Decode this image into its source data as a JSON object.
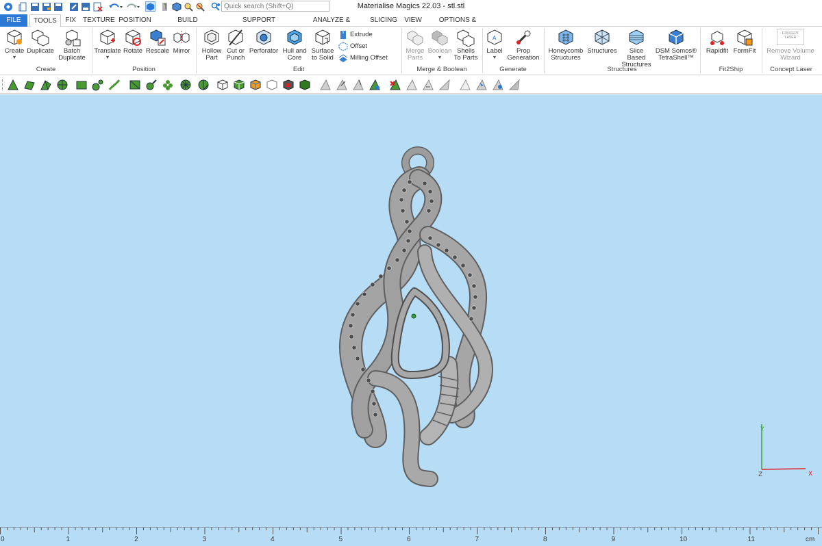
{
  "app": {
    "title": "Materialise Magics 22.03 - stl.stl"
  },
  "quick_search": {
    "placeholder": "Quick search (Shift+Q)"
  },
  "menu_tabs": [
    {
      "label": "FILE"
    },
    {
      "label": "TOOLS"
    },
    {
      "label": "FIX"
    },
    {
      "label": "TEXTURE"
    },
    {
      "label": "POSITION"
    },
    {
      "label": "BUILD PREPARATION"
    },
    {
      "label": "SUPPORT GENERATION"
    },
    {
      "label": "ANALYZE & REPORT"
    },
    {
      "label": "SLICING"
    },
    {
      "label": "VIEW"
    },
    {
      "label": "OPTIONS & HELP"
    }
  ],
  "active_tab": "TOOLS",
  "ribbon": {
    "create": {
      "group_label": "Create",
      "create": "Create",
      "duplicate": "Duplicate",
      "batch_duplicate_1": "Batch",
      "batch_duplicate_2": "Duplicate"
    },
    "position": {
      "group_label": "Position",
      "translate": "Translate",
      "rotate": "Rotate",
      "rescale": "Rescale",
      "mirror": "Mirror"
    },
    "edit": {
      "group_label": "Edit",
      "hollow_1": "Hollow",
      "hollow_2": "Part",
      "cut_1": "Cut or",
      "cut_2": "Punch",
      "perforator": "Perforator",
      "hull_1": "Hull and",
      "hull_2": "Core",
      "surface_1": "Surface",
      "surface_2": "to Solid",
      "extrude": "Extrude",
      "offset": "Offset",
      "milling_offset": "Milling Offset"
    },
    "merge": {
      "group_label": "Merge & Boolean",
      "merge_1": "Merge",
      "merge_2": "Parts",
      "boolean": "Boolean",
      "shells_1": "Shells",
      "shells_2": "To Parts"
    },
    "generate": {
      "group_label": "Generate",
      "label": "Label",
      "prop_1": "Prop",
      "prop_2": "Generation"
    },
    "structures": {
      "group_label": "Structures",
      "honeycomb_1": "Honeycomb",
      "honeycomb_2": "Structures",
      "structures": "Structures",
      "slice_1": "Slice Based",
      "slice_2": "Structures",
      "dsm_1": "DSM Somos®",
      "dsm_2": "TetraShell™"
    },
    "fit2ship": {
      "group_label": "Fit2Ship",
      "rapidfit": "Rapidfit",
      "formfit": "FormFit"
    },
    "concept_laser": {
      "group_label": "Concept Laser",
      "logo_text": "CONCEPT LASER",
      "remove_1": "Remove Volume",
      "remove_2": "Wizard"
    }
  },
  "axis": {
    "y": "Y",
    "z": "Z",
    "x": "X"
  },
  "ruler": {
    "labels": [
      "0",
      "1",
      "2",
      "3",
      "4",
      "5",
      "6",
      "7",
      "8",
      "9",
      "10",
      "11"
    ],
    "unit": "cm"
  },
  "colors": {
    "viewport_bg": "#b7dcf6",
    "file_tab": "#2b79d6",
    "model": "#9d9d9d"
  }
}
